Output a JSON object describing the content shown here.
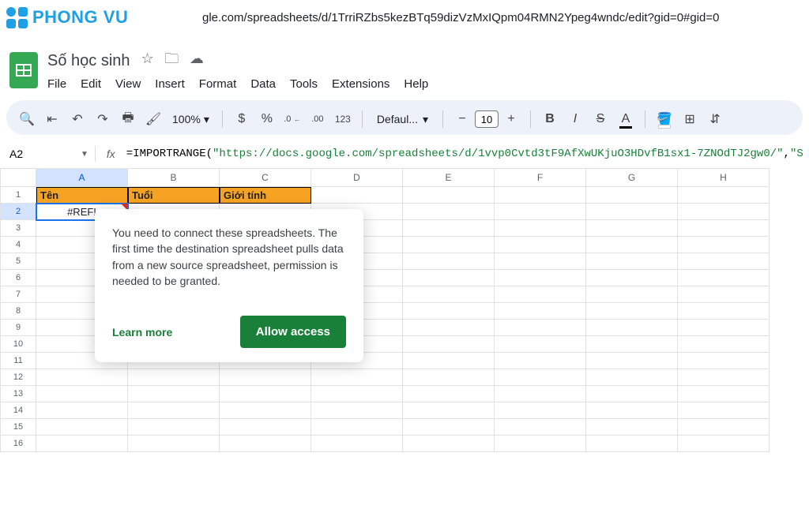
{
  "browser": {
    "url": "gle.com/spreadsheets/d/1TrriRZbs5kezBTq59dizVzMxIQpm04RMN2Ypeg4wndc/edit?gid=0#gid=0"
  },
  "logo": {
    "text": "PHONG VU"
  },
  "doc": {
    "title": "Số học sinh"
  },
  "menu": {
    "file": "File",
    "edit": "Edit",
    "view": "View",
    "insert": "Insert",
    "format": "Format",
    "data": "Data",
    "tools": "Tools",
    "extensions": "Extensions",
    "help": "Help"
  },
  "toolbar": {
    "zoom": "100%",
    "currency": "$",
    "percent": "%",
    "dec_dec": ".0",
    "inc_dec": ".00",
    "num123": "123",
    "font": "Defaul...",
    "size": "10",
    "minus": "−",
    "plus": "+",
    "bold": "B",
    "italic": "I",
    "strike": "S",
    "textcolor": "A"
  },
  "namebox": {
    "cell": "A2",
    "fx": "fx"
  },
  "formula": {
    "prefix": "=IMPORTRANGE(",
    "arg1": "\"https://docs.google.com/spreadsheets/d/1vvp0Cvtd3tF9AfXwUKjuO3HDvfB1sx1-7ZNOdTJ2gw0/\"",
    "comma": ",",
    "arg2": "\"Shee"
  },
  "columns": [
    "A",
    "B",
    "C",
    "D",
    "E",
    "F",
    "G",
    "H"
  ],
  "row_count": 16,
  "headers": {
    "a": "Tên",
    "b": "Tuổi",
    "c": "Giới tính"
  },
  "cells": {
    "a2": "#REF!"
  },
  "popover": {
    "text": "You need to connect these spreadsheets. The first time the destination spreadsheet pulls data from a new source spreadsheet, permission is needed to be granted.",
    "learn": "Learn more",
    "allow": "Allow access"
  },
  "chart_data": {
    "type": "table",
    "columns": [
      "Tên",
      "Tuổi",
      "Giới tính"
    ],
    "rows": []
  }
}
